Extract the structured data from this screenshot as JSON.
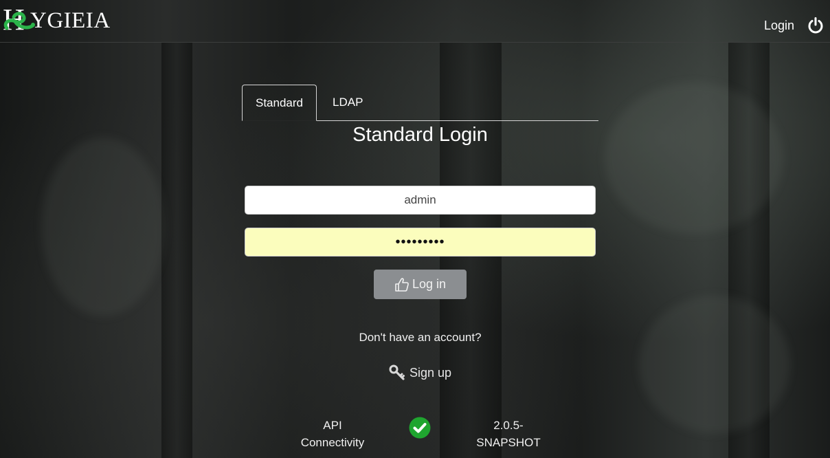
{
  "header": {
    "logo_letter": "H",
    "logo_text": "YGIEIA",
    "login_label": "Login",
    "power_icon": "power-icon"
  },
  "tabs": [
    {
      "label": "Standard",
      "active": true
    },
    {
      "label": "LDAP",
      "active": false
    }
  ],
  "form": {
    "title": "Standard Login",
    "username_value": "admin",
    "password_value": "•••••••••",
    "login_button_label": "Log in",
    "login_button_icon": "thumbs-up-icon"
  },
  "signup": {
    "prompt": "Don't have an account?",
    "label": "Sign up",
    "icon": "key-icon"
  },
  "status": {
    "api_label_line1": "API",
    "api_label_line2": "Connectivity",
    "api_status_icon": "check-circle-icon",
    "api_status_color": "#1fa52f",
    "version_line1": "2.0.5-",
    "version_line2": "SNAPSHOT"
  }
}
